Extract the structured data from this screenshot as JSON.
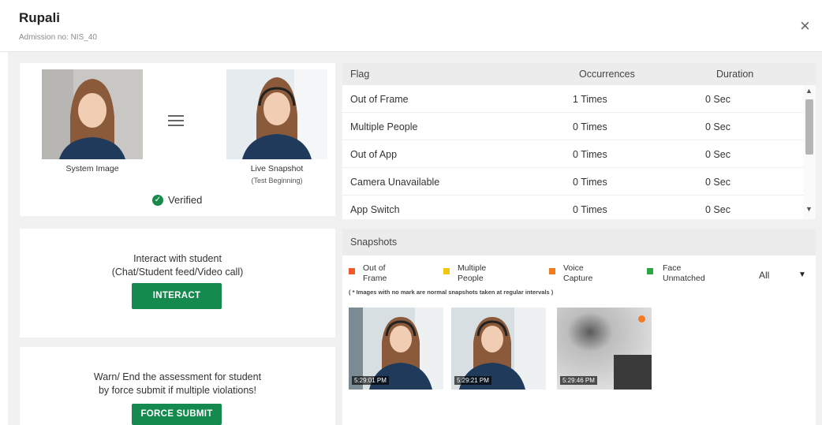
{
  "header": {
    "title": "Rupali",
    "subtitle": "Admission no: NIS_40",
    "close_label": "×"
  },
  "identity": {
    "system_image_caption": "System Image",
    "live_snapshot_caption": "Live Snapshot",
    "live_snapshot_sub": "(Test Beginning)",
    "verified_label": "Verified",
    "verified_icon": "✓"
  },
  "interact": {
    "line1": "Interact with student",
    "line2": "(Chat/Student feed/Video call)",
    "button_label": "INTERACT"
  },
  "warn": {
    "line1": "Warn/ End the assessment for student",
    "line2": "by force submit if multiple violations!",
    "button_label": "FORCE SUBMIT"
  },
  "flags": {
    "headers": {
      "flag": "Flag",
      "occurrences": "Occurrences",
      "duration": "Duration"
    },
    "rows": [
      {
        "flag": "Out of Frame",
        "occurrences": "1 Times",
        "duration": "0 Sec"
      },
      {
        "flag": "Multiple People",
        "occurrences": "0 Times",
        "duration": "0 Sec"
      },
      {
        "flag": "Out of App",
        "occurrences": "0 Times",
        "duration": "0 Sec"
      },
      {
        "flag": "Camera Unavailable",
        "occurrences": "0 Times",
        "duration": "0 Sec"
      },
      {
        "flag": "App Switch",
        "occurrences": "0 Times",
        "duration": "0 Sec"
      }
    ]
  },
  "snapshots": {
    "title": "Snapshots",
    "legend": [
      {
        "line1": "Out of",
        "line2": "Frame",
        "color": "#f05a28"
      },
      {
        "line1": "Multiple",
        "line2": "People",
        "color": "#f2c511"
      },
      {
        "line1": "Voice",
        "line2": "Capture",
        "color": "#f47a1f"
      },
      {
        "line1": "Face",
        "line2": "Unmatched",
        "color": "#27a844"
      }
    ],
    "filter_value": "All",
    "filter_arrow": "▼",
    "note": "( * Images with no mark are normal snapshots taken at regular intervals )",
    "thumbs": [
      {
        "time": "5:29:01 PM",
        "mark": ""
      },
      {
        "time": "5:29:21 PM",
        "mark": ""
      },
      {
        "time": "5:29:46 PM",
        "mark": "#f47a1f"
      }
    ]
  }
}
